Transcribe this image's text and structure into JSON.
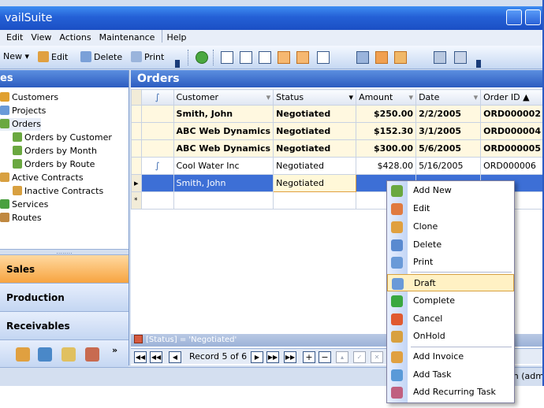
{
  "app": {
    "title": "vailSuite"
  },
  "menu": [
    "Edit",
    "View",
    "Actions",
    "Maintenance",
    "Help"
  ],
  "toolbar": {
    "new_label": "New",
    "new_arrow": "▾",
    "edit_label": "Edit",
    "delete_label": "Delete",
    "print_label": "Print"
  },
  "nav": {
    "header": "es",
    "tree": [
      {
        "label": "Customers",
        "icon": "customers-icon",
        "color": "#e0a030"
      },
      {
        "label": "Projects",
        "icon": "projects-icon",
        "color": "#6a9ad8"
      },
      {
        "label": "Orders",
        "icon": "orders-icon",
        "color": "#6aa840"
      },
      {
        "label": "Orders by Customer",
        "icon": "order-filter-icon",
        "color": "#6aa840"
      },
      {
        "label": "Orders by Month",
        "icon": "order-filter-icon",
        "color": "#6aa840"
      },
      {
        "label": "Orders by Route",
        "icon": "order-filter-icon",
        "color": "#6aa840"
      },
      {
        "label": "Active Contracts",
        "icon": "contracts-icon",
        "color": "#d8a040"
      },
      {
        "label": "Inactive Contracts",
        "icon": "contracts-icon",
        "color": "#d8a040"
      },
      {
        "label": "Services",
        "icon": "services-icon",
        "color": "#4aa040"
      },
      {
        "label": "Routes",
        "icon": "routes-icon",
        "color": "#c08840"
      }
    ],
    "splitter": "........",
    "sections": [
      "Sales",
      "Production",
      "Receivables"
    ],
    "more_glyph": "»"
  },
  "orders": {
    "title": "Orders",
    "columns": [
      "Customer",
      "Status",
      "Amount",
      "Date",
      "Order ID"
    ],
    "sort_glyph": "▲",
    "rows": [
      {
        "customer": "Smith, John",
        "status": "Negotiated",
        "amount": "$250.00",
        "date": "2/2/2005",
        "id": "ORD000002",
        "bold": true,
        "attach": false
      },
      {
        "customer": "ABC Web Dynamics",
        "status": "Negotiated",
        "amount": "$152.30",
        "date": "3/1/2005",
        "id": "ORD000004",
        "bold": true,
        "attach": false
      },
      {
        "customer": "ABC Web Dynamics",
        "status": "Negotiated",
        "amount": "$300.00",
        "date": "5/6/2005",
        "id": "ORD000005",
        "bold": true,
        "attach": false
      },
      {
        "customer": "Cool Water Inc",
        "status": "Negotiated",
        "amount": "$428.00",
        "date": "5/16/2005",
        "id": "ORD000006",
        "bold": false,
        "attach": true
      },
      {
        "customer": "Smith, John",
        "status": "Negotiated",
        "amount": "",
        "date": "",
        "id": "",
        "bold": false,
        "attach": false,
        "active": true
      }
    ],
    "filter": "[Status] = 'Negotiated'",
    "record_text": "Record 5 of 6"
  },
  "status": {
    "right_text": "in (adm"
  },
  "context_menu": {
    "items": [
      {
        "label": "Add New",
        "icon": "add-new-icon",
        "color": "#6aa840"
      },
      {
        "label": "Edit",
        "icon": "edit-icon",
        "color": "#e07a40"
      },
      {
        "label": "Clone",
        "icon": "clone-icon",
        "color": "#e0a040"
      },
      {
        "label": "Delete",
        "icon": "delete-icon",
        "color": "#5a8ad0"
      },
      {
        "label": "Print",
        "icon": "print-icon",
        "color": "#6a9ad8"
      },
      {
        "label": "Draft",
        "icon": "draft-icon",
        "color": "#6a9ad8",
        "hover": true
      },
      {
        "label": "Complete",
        "icon": "complete-icon",
        "color": "#3aa840"
      },
      {
        "label": "Cancel",
        "icon": "cancel-icon",
        "color": "#e05a30"
      },
      {
        "label": "OnHold",
        "icon": "onhold-icon",
        "color": "#d8a040"
      },
      {
        "label": "Add Invoice",
        "icon": "add-invoice-icon",
        "color": "#e0a040"
      },
      {
        "label": "Add Task",
        "icon": "add-task-icon",
        "color": "#5a9ad8"
      },
      {
        "label": "Add Recurring Task",
        "icon": "add-recurring-task-icon",
        "color": "#c06080"
      }
    ]
  }
}
